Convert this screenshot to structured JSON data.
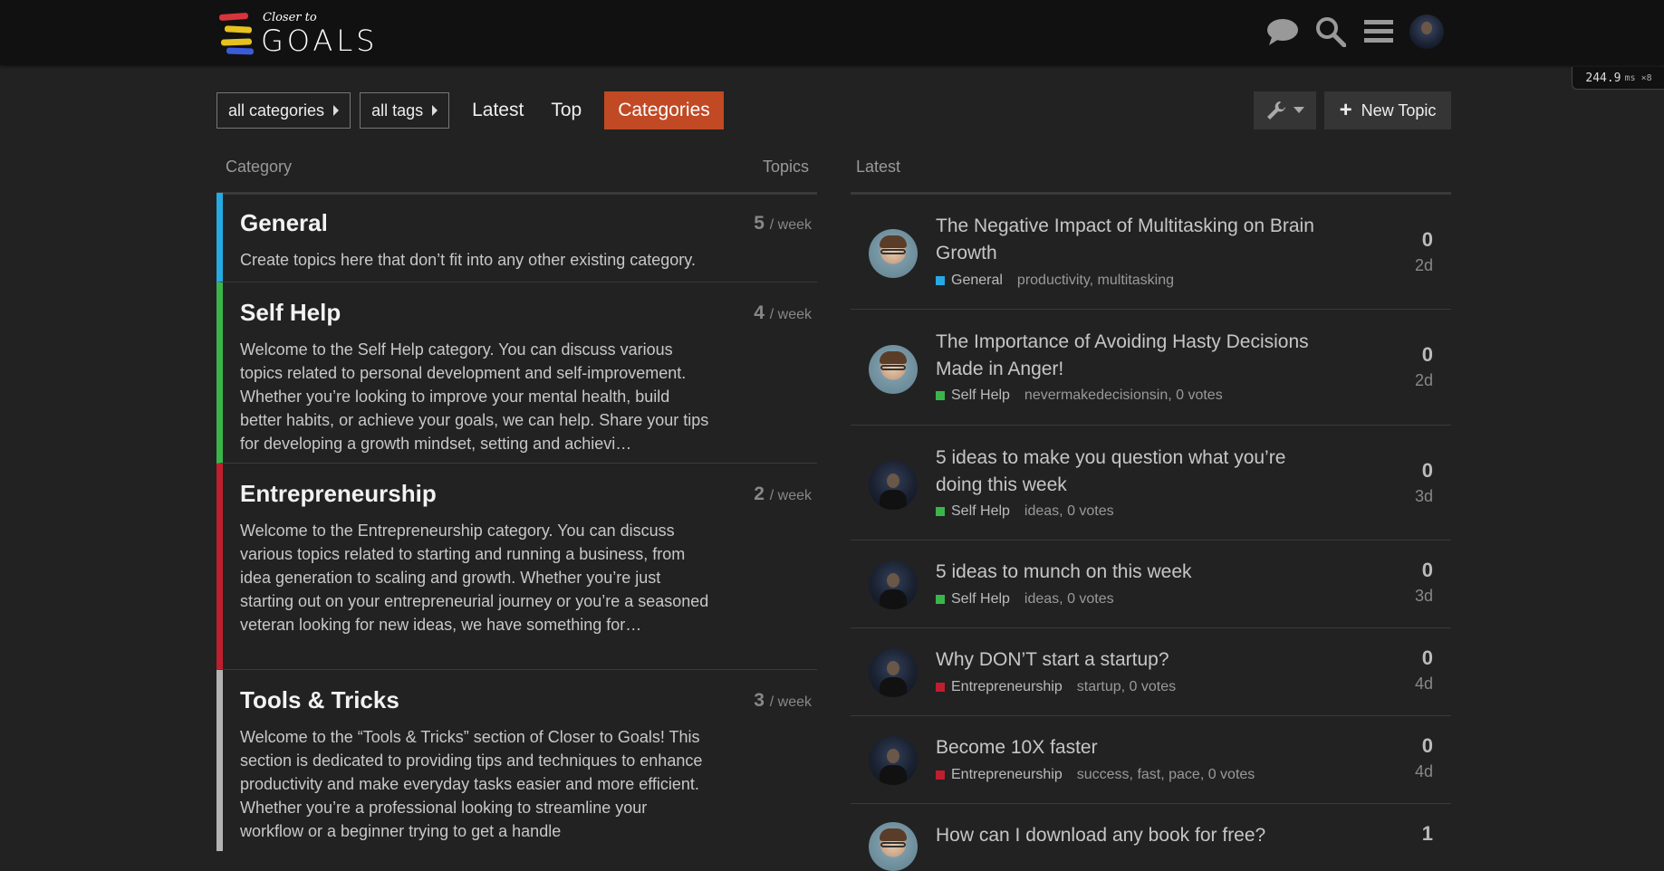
{
  "header": {
    "logo_small": "Closer to",
    "logo_big": "GOALS"
  },
  "perf": {
    "value": "244.9",
    "unit": "ms ×8"
  },
  "nav": {
    "categories_dropdown": "all categories",
    "tags_dropdown": "all tags",
    "latest": "Latest",
    "top": "Top",
    "categories": "Categories",
    "new_topic": "New Topic"
  },
  "columns": {
    "category": "Category",
    "topics": "Topics",
    "latest": "Latest"
  },
  "categories": [
    {
      "name": "General",
      "color": "#25aae1",
      "count": "5",
      "unit": "/ week",
      "desc": "Create topics here that don’t fit into any other existing category."
    },
    {
      "name": "Self Help",
      "color": "#3ab54a",
      "count": "4",
      "unit": "/ week",
      "desc": "Welcome to the Self Help category. You can discuss various topics related to personal development and self-improvement. Whether you’re looking to improve your mental health, build better habits, or achieve your goals, we can help. Share your tips for developing a growth mindset, setting and achievi…"
    },
    {
      "name": "Entrepreneurship",
      "color": "#bf1e2e",
      "count": "2",
      "unit": "/ week",
      "desc": "Welcome to the Entrepreneurship category. You can discuss various topics related to starting and running a business, from idea generation to scaling and growth. Whether you’re just starting out on your entrepreneurial journey or you’re a seasoned veteran looking for new ideas, we have something for…"
    },
    {
      "name": "Tools & Tricks",
      "color": "#b3b3b3",
      "count": "3",
      "unit": "/ week",
      "desc": "Welcome to the “Tools & Tricks” section of Closer to Goals! This section is dedicated to providing tips and techniques to enhance productivity and make everyday tasks easier and more efficient. Whether you’re a professional looking to streamline your workflow or a beginner trying to get a handle"
    }
  ],
  "topics": [
    {
      "title": "The Negative Impact of Multitasking on Brain Growth",
      "category": "General",
      "color": "#25aae1",
      "tags": "productivity, multitasking",
      "count": "0",
      "age": "2d"
    },
    {
      "title": "The Importance of Avoiding Hasty Decisions Made in Anger!",
      "category": "Self Help",
      "color": "#3ab54a",
      "tags": "nevermakedecisionsin, 0 votes",
      "count": "0",
      "age": "2d"
    },
    {
      "title": "5 ideas to make you question what you’re doing this week",
      "category": "Self Help",
      "color": "#3ab54a",
      "tags": "ideas, 0 votes",
      "count": "0",
      "age": "3d"
    },
    {
      "title": "5 ideas to munch on this week",
      "category": "Self Help",
      "color": "#3ab54a",
      "tags": "ideas, 0 votes",
      "count": "0",
      "age": "3d"
    },
    {
      "title": "Why DON’T start a startup?",
      "category": "Entrepreneurship",
      "color": "#bf1e2e",
      "tags": "startup, 0 votes",
      "count": "0",
      "age": "4d"
    },
    {
      "title": "Become 10X faster",
      "category": "Entrepreneurship",
      "color": "#bf1e2e",
      "tags": "success, fast, pace, 0 votes",
      "count": "0",
      "age": "4d"
    },
    {
      "title": "How can I download any book for free?",
      "category": "",
      "color": "#25aae1",
      "tags": "",
      "count": "1",
      "age": ""
    }
  ]
}
